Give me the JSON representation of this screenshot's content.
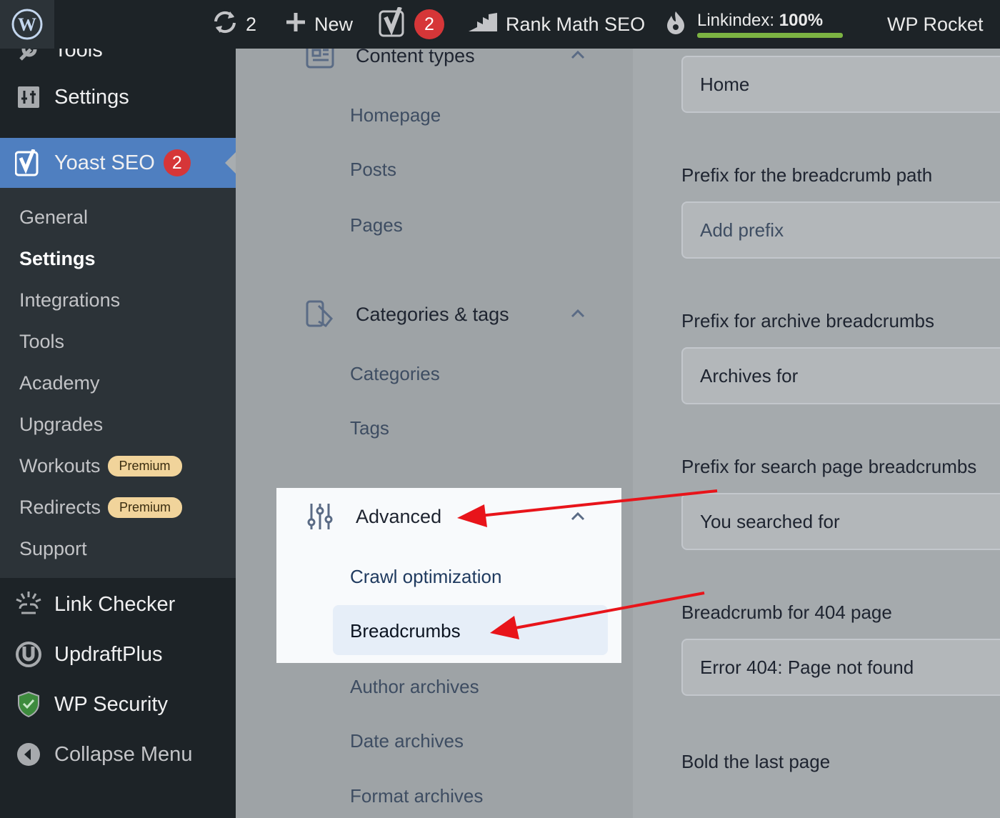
{
  "admin_bar": {
    "updates_count": "2",
    "new_label": "New",
    "yoast_badge": "2",
    "rank_math_label": "Rank Math SEO",
    "linkindex_label": "Linkindex: ",
    "linkindex_value": "100%",
    "linkindex_progress": 1.0,
    "wp_rocket_label": "WP Rocket"
  },
  "admin_menu": {
    "tools_label": "Tools",
    "settings_label": "Settings",
    "yoast_label": "Yoast SEO",
    "yoast_badge": "2",
    "submenu": [
      {
        "label": "General"
      },
      {
        "label": "Settings",
        "current": true
      },
      {
        "label": "Integrations"
      },
      {
        "label": "Tools"
      },
      {
        "label": "Academy"
      },
      {
        "label": "Upgrades"
      },
      {
        "label": "Workouts",
        "tag": "Premium"
      },
      {
        "label": "Redirects",
        "tag": "Premium"
      },
      {
        "label": "Support"
      }
    ],
    "link_checker_label": "Link Checker",
    "updraftplus_label": "UpdraftPlus",
    "wp_security_label": "WP Security",
    "collapse_label": "Collapse Menu"
  },
  "settings_nav": {
    "content_types": {
      "label": "Content types",
      "items": [
        "Homepage",
        "Posts",
        "Pages"
      ]
    },
    "categories_tags": {
      "label": "Categories & tags",
      "items": [
        "Categories",
        "Tags"
      ]
    },
    "advanced": {
      "label": "Advanced",
      "items": [
        "Crawl optimization",
        "Breadcrumbs",
        "Author archives",
        "Date archives",
        "Format archives"
      ]
    }
  },
  "breadcrumb_settings": {
    "home_anchor_value": "Home",
    "prefix_path_label": "Prefix for the breadcrumb path",
    "prefix_path_placeholder": "Add prefix",
    "archive_prefix_label": "Prefix for archive breadcrumbs",
    "archive_prefix_value": "Archives for",
    "search_prefix_label": "Prefix for search page breadcrumbs",
    "search_prefix_value": "You searched for",
    "error404_label": "Breadcrumb for 404 page",
    "error404_value": "Error 404: Page not found",
    "bold_last_label": "Bold the last page"
  },
  "colors": {
    "admin_bg": "#1d2327",
    "yoast_active": "#4f7fc0",
    "badge_red": "#d63638",
    "annotation_arrow": "#e8141a",
    "linkindex_green": "#7cb342"
  }
}
